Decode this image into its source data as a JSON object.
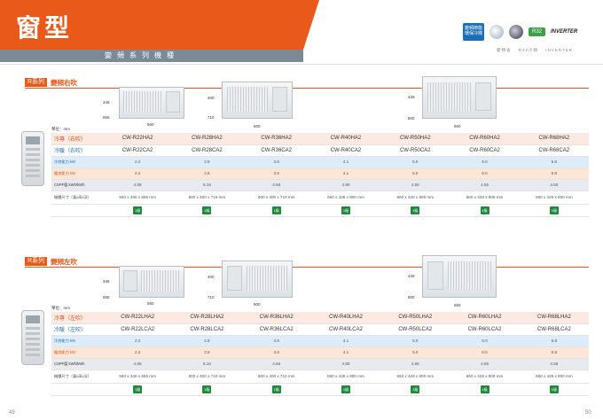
{
  "header": {
    "title": "窗型",
    "subtitle": "變頻系列機種"
  },
  "badges": {
    "blue_badge": "變頻節能 環保冷媒",
    "r32": "R32",
    "inverter": "INVERTER",
    "caption": "變頻省 R32冷媒 INVERTER"
  },
  "sections": [
    {
      "series_tag": "R系列",
      "direction": "變頻右吹",
      "units": [
        {
          "dim_h": "346",
          "dim_d": "655",
          "dim_w": "560"
        },
        {
          "dim_h": "400",
          "dim_d": "710",
          "dim_w": "600"
        },
        {
          "dim_h": "428",
          "dim_d": "800",
          "dim_w": "660"
        }
      ],
      "table": {
        "unit_note": "單位：mm",
        "rows": [
          {
            "label": "冷專（右吹）",
            "values": [
              "CW-R22HA2",
              "CW-R28HA2",
              "CW-R36HA2",
              "CW-R40HA2",
              "CW-R50HA2",
              "CW-R60HA2",
              "CW-R68HA2"
            ]
          },
          {
            "label": "冷暖（右吹）",
            "values": [
              "CW-R22CA2",
              "CW-R28CA2",
              "CW-R36CA2",
              "CW-R40CA2",
              "CW-R50CA2",
              "CW-R60CA2",
              "CW-R68CA2"
            ]
          },
          {
            "label": "冷房能力 kW",
            "values": [
              "2.2",
              "2.8",
              "3.6",
              "4.1",
              "5.0",
              "6.0",
              "6.8"
            ]
          },
          {
            "label": "暖房能力 kW",
            "values": [
              "2.2",
              "2.8",
              "3.6",
              "4.1",
              "5.0",
              "6.0",
              "6.8"
            ]
          },
          {
            "label": "CSPF值 kWh/kWh",
            "values": [
              "4.08",
              "5.16",
              "4.66",
              "4.90",
              "4.55",
              "4.55",
              "4.50"
            ]
          },
          {
            "label": "機體尺寸（寬x高x深）",
            "values": [
              "560 x 346 x 655 mm",
              "600 x 400 x 710 mm",
              "600 x 400 x 710 mm",
              "660 x 428 x 800 mm",
              "660 x 428 x 800 mm",
              "660 x 428 x 800 mm",
              "660 x 428 x 800 mm"
            ]
          },
          {
            "label": "",
            "values": [
              "1級",
              "1級",
              "1級",
              "1級",
              "1級",
              "1級",
              "1級"
            ]
          }
        ]
      }
    },
    {
      "series_tag": "R系列",
      "direction": "變頻左吹",
      "units": [
        {
          "dim_h": "346",
          "dim_d": "655",
          "dim_w": "560"
        },
        {
          "dim_h": "400",
          "dim_d": "710",
          "dim_w": "600"
        },
        {
          "dim_h": "428",
          "dim_d": "800",
          "dim_w": "660"
        }
      ],
      "table": {
        "unit_note": "單位：mm",
        "rows": [
          {
            "label": "冷專（左吹）",
            "values": [
              "CW-R22LHA2",
              "CW-R28LHA2",
              "CW-R36LHA2",
              "CW-R40LHA2",
              "CW-R50LHA2",
              "CW-R60LHA2",
              "CW-R68LHA2"
            ]
          },
          {
            "label": "冷暖（左吹）",
            "values": [
              "CW-R22LCA2",
              "CW-R28LCA2",
              "CW-R36LCA2",
              "CW-R40LCA2",
              "CW-R50LCA2",
              "CW-R60LCA2",
              "CW-R68LCA2"
            ]
          },
          {
            "label": "冷房能力 kW",
            "values": [
              "2.2",
              "2.8",
              "3.6",
              "4.1",
              "5.0",
              "6.0",
              "6.8"
            ]
          },
          {
            "label": "暖房能力 kW",
            "values": [
              "2.2",
              "2.8",
              "3.6",
              "4.1",
              "5.0",
              "6.0",
              "6.8"
            ]
          },
          {
            "label": "CSPF值 kWh/kWh",
            "values": [
              "4.08",
              "5.16",
              "4.66",
              "4.90",
              "4.55",
              "4.55",
              "4.55"
            ]
          },
          {
            "label": "機體尺寸（寬x高x深）",
            "values": [
              "560 x 346 x 655 mm",
              "600 x 400 x 710 mm",
              "600 x 400 x 710 mm",
              "660 x 428 x 800 mm",
              "660 x 428 x 800 mm",
              "660 x 428 x 800 mm",
              "660 x 428 x 800 mm"
            ]
          },
          {
            "label": "",
            "values": [
              "1級",
              "1級",
              "1級",
              "1級",
              "1級",
              "1級",
              "1級"
            ]
          }
        ]
      }
    }
  ],
  "footer": {
    "page_left": "49",
    "page_right": "50"
  }
}
